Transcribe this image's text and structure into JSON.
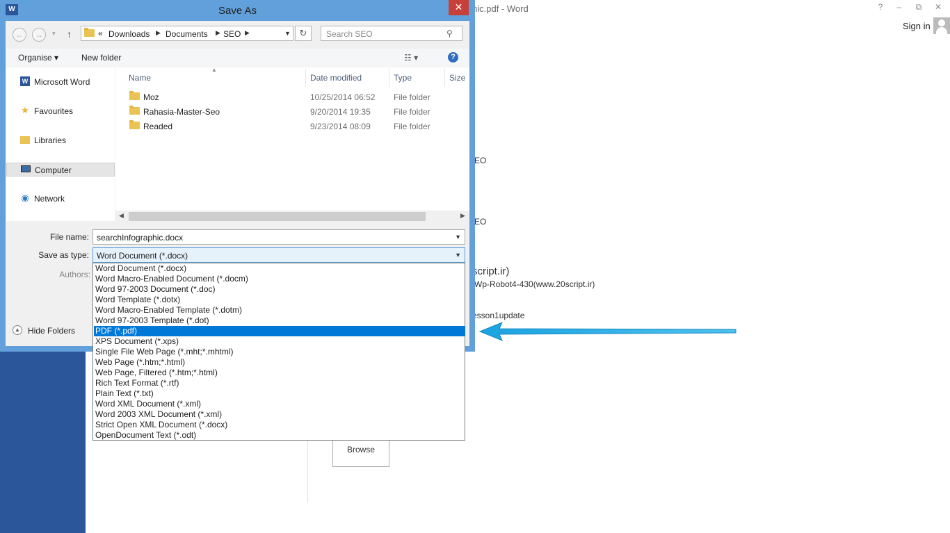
{
  "word": {
    "title": "hic.pdf - Word",
    "controls": [
      "?",
      "–",
      "⧉",
      "✕"
    ],
    "sign_in": "Sign in",
    "recent": [
      "EO",
      "EO",
      "script.ir)",
      "Wp-Robot4-430(www.20script.ir)",
      "esson1update"
    ],
    "browse": "Browse"
  },
  "dialog": {
    "title": "Save As",
    "app_icon": "W",
    "close": "✕",
    "nav": {
      "back": "←",
      "forward": "→",
      "dropdown": "▾",
      "up": "↑"
    },
    "breadcrumb": [
      "«",
      "Downloads",
      "Documents",
      "SEO"
    ],
    "refresh": "↻",
    "search_placeholder": "Search SEO",
    "toolbar": {
      "organise": "Organise ▾",
      "new_folder": "New folder",
      "view": "☷ ▾",
      "help": "?"
    },
    "nav_pane": [
      "Microsoft Word",
      "Favourites",
      "Libraries",
      "Computer",
      "Network"
    ],
    "columns": [
      "Name",
      "Date modified",
      "Type",
      "Size"
    ],
    "files": [
      {
        "name": "Moz",
        "date": "10/25/2014 06:52",
        "type": "File folder"
      },
      {
        "name": "Rahasia-Master-Seo",
        "date": "9/20/2014 19:35",
        "type": "File folder"
      },
      {
        "name": "Readed",
        "date": "9/23/2014 08:09",
        "type": "File folder"
      }
    ],
    "file_name_label": "File name:",
    "file_name": "searchInfographic.docx",
    "save_type_label": "Save as type:",
    "save_type": "Word Document (*.docx)",
    "authors_label": "Authors:",
    "hide_folders": "Hide Folders",
    "type_options": [
      "Word Document (*.docx)",
      "Word Macro-Enabled Document (*.docm)",
      "Word 97-2003 Document (*.doc)",
      "Word Template (*.dotx)",
      "Word Macro-Enabled Template (*.dotm)",
      "Word 97-2003 Template (*.dot)",
      "PDF (*.pdf)",
      "XPS Document (*.xps)",
      "Single File Web Page (*.mht;*.mhtml)",
      "Web Page (*.htm;*.html)",
      "Web Page, Filtered (*.htm;*.html)",
      "Rich Text Format (*.rtf)",
      "Plain Text (*.txt)",
      "Word XML Document (*.xml)",
      "Word 2003 XML Document (*.xml)",
      "Strict Open XML Document (*.docx)",
      "OpenDocument Text (*.odt)"
    ],
    "selected_option": "PDF (*.pdf)"
  },
  "colors": {
    "accent": "#0078d7",
    "word_blue": "#2b579a",
    "annotation_arrow": "#1aa3df"
  }
}
